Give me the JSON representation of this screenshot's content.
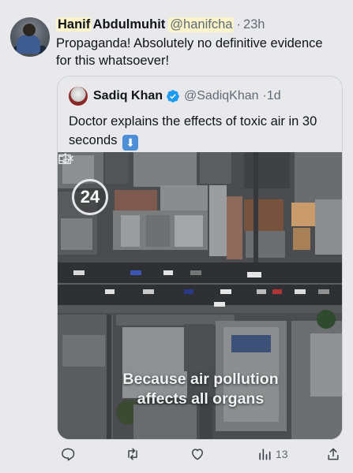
{
  "tweet": {
    "author_name": "Hanif Abdulmuhit",
    "author_name_first": "Hanif",
    "author_name_last": "Abdulmuhit",
    "handle": "@hanifcha",
    "separator": "·",
    "time": "23h",
    "text": "Propaganda! Absolutely no definitive evidence for this whatsoever!"
  },
  "quoted": {
    "author_name": "Sadiq Khan",
    "handle": "@SadiqKhan",
    "separator": "·",
    "time": "1d",
    "verified": true,
    "text": "Doctor explains the effects of toxic air in 30 seconds",
    "emoji": "⬇",
    "media": {
      "badge": "24",
      "caption_line1": "Because air pollution",
      "caption_line2": "affects all organs"
    }
  },
  "actions": {
    "reply_icon": "reply-icon",
    "retweet_icon": "retweet-icon",
    "like_icon": "like-icon",
    "views_icon": "views-icon",
    "views_count": "13",
    "share_icon": "share-icon"
  },
  "colors": {
    "background": "#e9e9ec",
    "highlight": "#fbf3c9",
    "verified": "#1d9bf0",
    "muted_text": "#5f6b76"
  }
}
